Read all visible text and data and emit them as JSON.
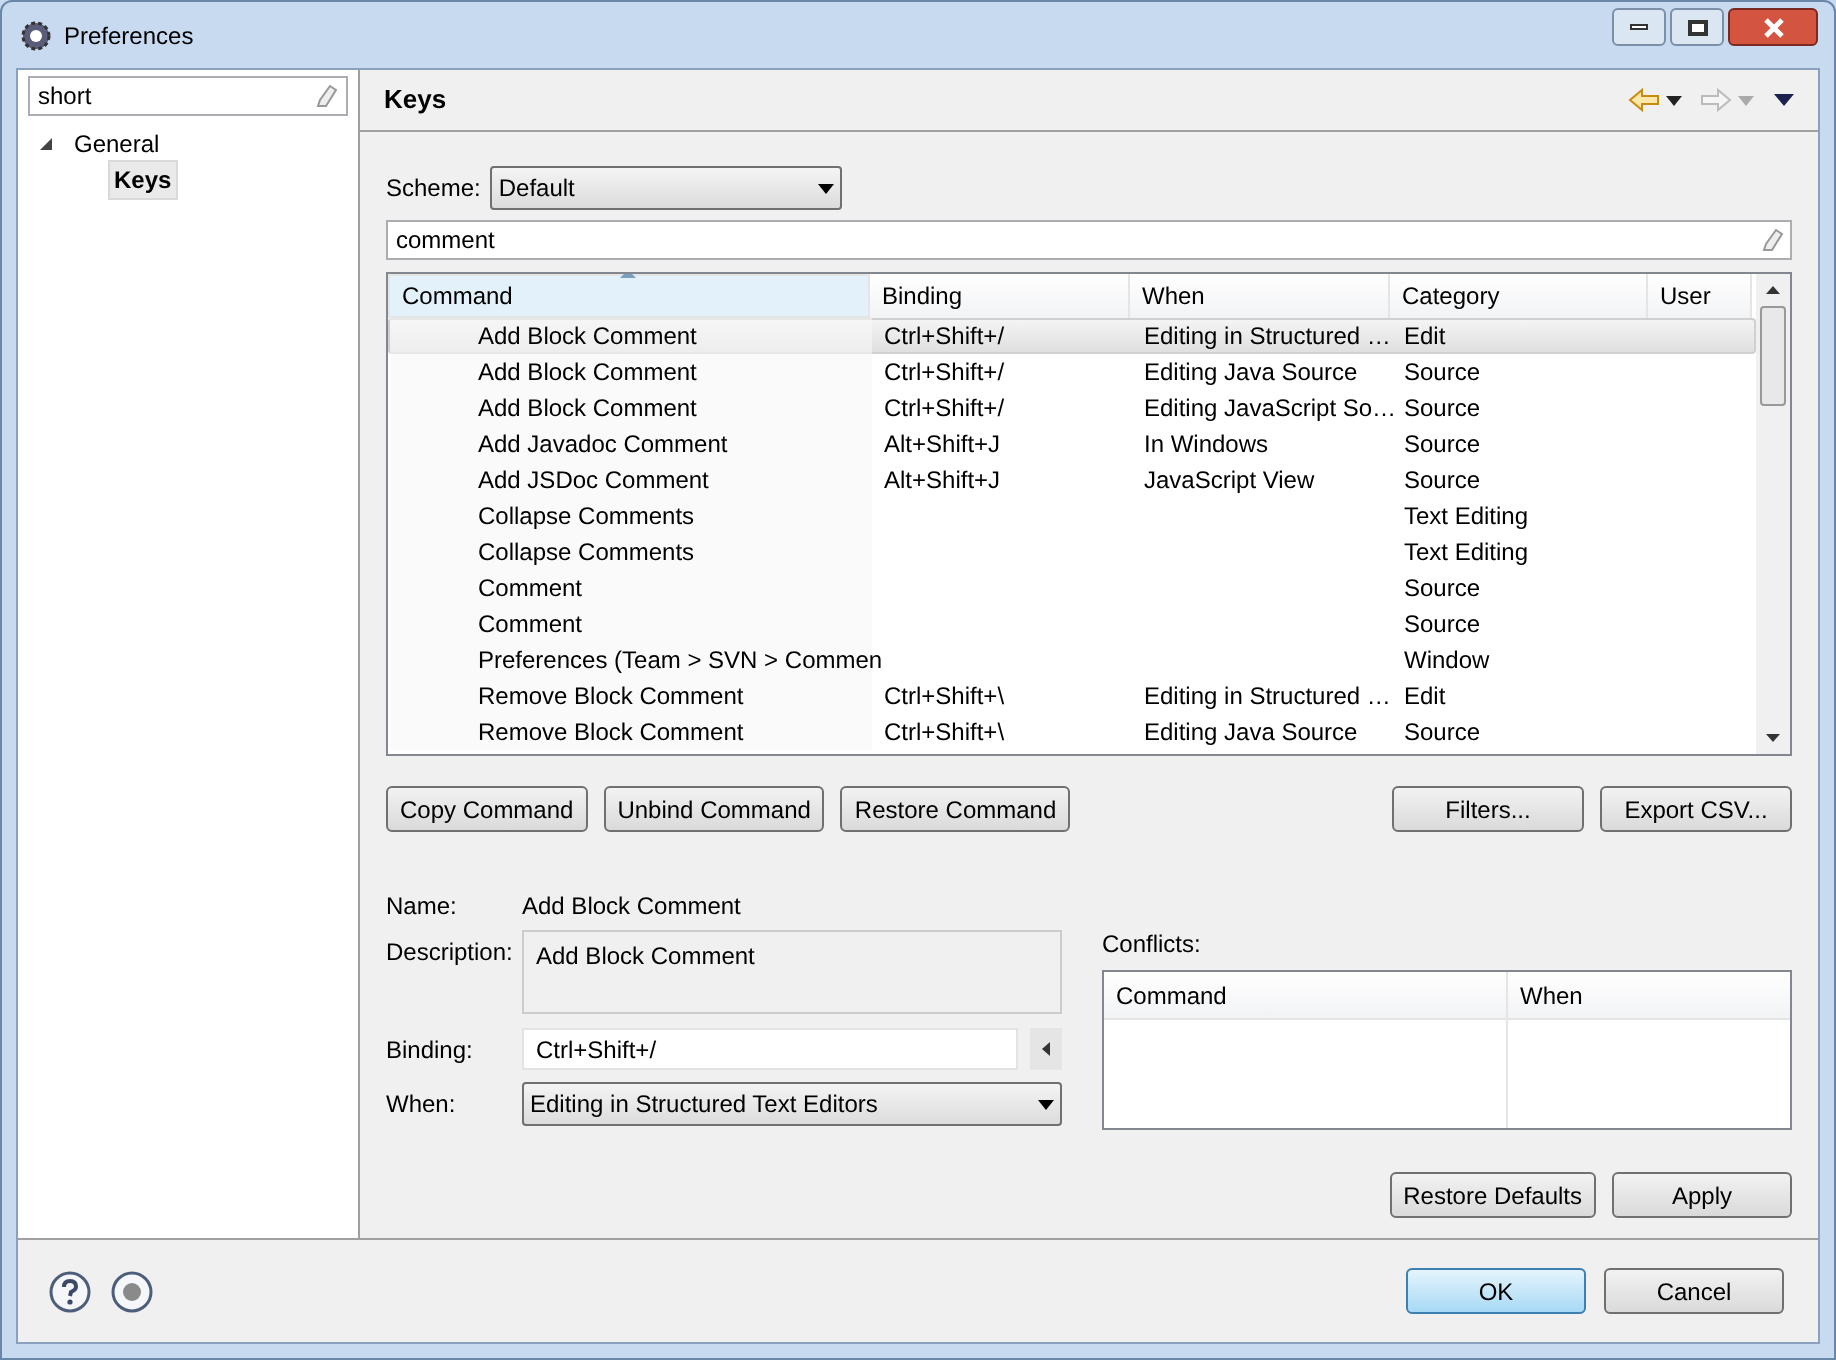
{
  "window": {
    "title": "Preferences"
  },
  "sidebar": {
    "filter": {
      "value": "short"
    },
    "tree": [
      {
        "label": "General",
        "expanded": true,
        "selected": false,
        "children": [
          {
            "label": "Keys",
            "selected": true
          }
        ]
      }
    ]
  },
  "page": {
    "title": "Keys"
  },
  "scheme": {
    "label": "Scheme:",
    "value": "Default"
  },
  "command_filter": {
    "value": "comment"
  },
  "table": {
    "columns": [
      {
        "label": "Command",
        "sorted": true
      },
      {
        "label": "Binding",
        "sorted": false
      },
      {
        "label": "When",
        "sorted": false
      },
      {
        "label": "Category",
        "sorted": false
      },
      {
        "label": "User",
        "sorted": false
      }
    ],
    "rows": [
      {
        "command": "Add Block Comment",
        "binding": "Ctrl+Shift+/",
        "when": "Editing in Structured …",
        "category": "Edit",
        "selected": true
      },
      {
        "command": "Add Block Comment",
        "binding": "Ctrl+Shift+/",
        "when": "Editing Java Source",
        "category": "Source",
        "selected": false
      },
      {
        "command": "Add Block Comment",
        "binding": "Ctrl+Shift+/",
        "when": "Editing JavaScript So…",
        "category": "Source",
        "selected": false
      },
      {
        "command": "Add Javadoc Comment",
        "binding": "Alt+Shift+J",
        "when": "In Windows",
        "category": "Source",
        "selected": false
      },
      {
        "command": "Add JSDoc Comment",
        "binding": "Alt+Shift+J",
        "when": "JavaScript View",
        "category": "Source",
        "selected": false
      },
      {
        "command": "Collapse Comments",
        "binding": "",
        "when": "",
        "category": "Text Editing",
        "selected": false
      },
      {
        "command": "Collapse Comments",
        "binding": "",
        "when": "",
        "category": "Text Editing",
        "selected": false
      },
      {
        "command": "Comment",
        "binding": "",
        "when": "",
        "category": "Source",
        "selected": false
      },
      {
        "command": "Comment",
        "binding": "",
        "when": "",
        "category": "Source",
        "selected": false
      },
      {
        "command": "Preferences (Team > SVN > Commen",
        "binding": "",
        "when": "",
        "category": "Window",
        "selected": false
      },
      {
        "command": "Remove Block Comment",
        "binding": "Ctrl+Shift+\\",
        "when": "Editing in Structured …",
        "category": "Edit",
        "selected": false
      },
      {
        "command": "Remove Block Comment",
        "binding": "Ctrl+Shift+\\",
        "when": "Editing Java Source",
        "category": "Source",
        "selected": false
      }
    ]
  },
  "command_buttons": [
    "Copy Command",
    "Unbind Command",
    "Restore Command"
  ],
  "table_buttons": [
    "Filters...",
    "Export CSV..."
  ],
  "details": {
    "name": {
      "label": "Name:",
      "value": "Add Block Comment"
    },
    "description": {
      "label": "Description:",
      "value": "Add Block Comment"
    },
    "binding": {
      "label": "Binding:",
      "value": "Ctrl+Shift+/"
    },
    "when": {
      "label": "When:",
      "value": "Editing in Structured Text Editors"
    }
  },
  "conflicts": {
    "label": "Conflicts:",
    "columns": [
      "Command",
      "When"
    ]
  },
  "page_buttons": [
    "Restore Defaults",
    "Apply"
  ],
  "dialog_buttons": [
    {
      "label": "OK",
      "default": true
    },
    {
      "label": "Cancel",
      "default": false
    }
  ]
}
